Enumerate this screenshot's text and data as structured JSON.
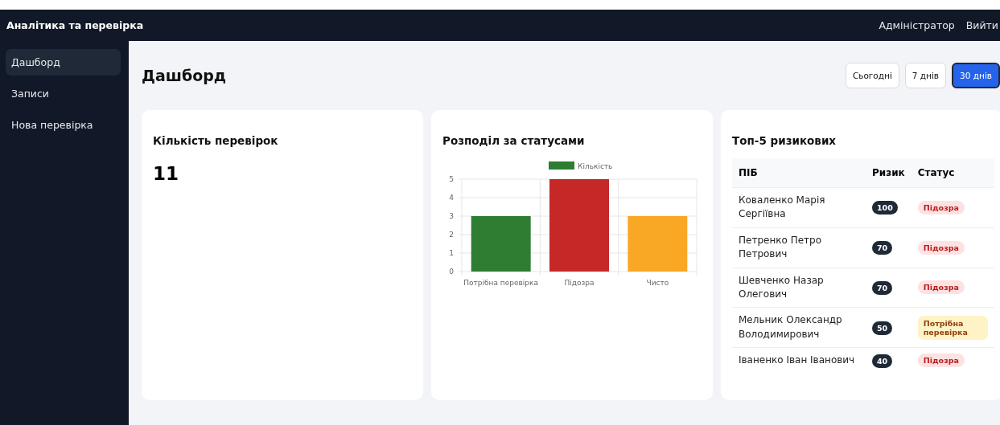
{
  "header": {
    "title": "Аналітика та перевірка",
    "user": "Адміністратор",
    "logout": "Вийти"
  },
  "sidebar": {
    "items": [
      {
        "label": "Дашборд",
        "selected": true
      },
      {
        "label": "Записи",
        "selected": false
      },
      {
        "label": "Нова перевірка",
        "selected": false
      }
    ]
  },
  "page": {
    "title": "Дашборд",
    "ranges": [
      {
        "label": "Сьогодні",
        "selected": false
      },
      {
        "label": "7 днів",
        "selected": false
      },
      {
        "label": "30 днів",
        "selected": true
      }
    ]
  },
  "count_card": {
    "title": "Кількість перевірок",
    "value": "11"
  },
  "status_card": {
    "title": "Розподіл за статусами",
    "chart_data": {
      "type": "bar",
      "categories": [
        "Потрібна перевірка",
        "Підозра",
        "Чисто"
      ],
      "series": [
        {
          "name": "Кількість",
          "color": "#2e7d32",
          "values": [
            3,
            null,
            null
          ]
        },
        {
          "color": "#c62828",
          "values": [
            null,
            5,
            null
          ]
        },
        {
          "color": "#f9a825",
          "values": [
            null,
            null,
            3
          ]
        }
      ],
      "stacked": true,
      "ylim": [
        0,
        5
      ],
      "yticks": [
        0,
        1,
        2,
        3,
        4,
        5
      ],
      "grid": true
    }
  },
  "top_card": {
    "title": "Топ-5 ризикових",
    "columns": [
      "ПІБ",
      "Ризик",
      "Статус"
    ],
    "rows": [
      {
        "name": "Коваленко Марія Сергіївна",
        "risk": "100",
        "status": "Підозра",
        "kind": "suspicious"
      },
      {
        "name": "Петренко Петро Петрович",
        "risk": "70",
        "status": "Підозра",
        "kind": "suspicious"
      },
      {
        "name": "Шевченко Назар Олегович",
        "risk": "70",
        "status": "Підозра",
        "kind": "suspicious"
      },
      {
        "name": "Мельник Олександр Володимирович",
        "risk": "50",
        "status": "Потрібна перевірка",
        "kind": "needs_check"
      },
      {
        "name": "Іваненко Іван Іванович",
        "risk": "40",
        "status": "Підозра",
        "kind": "suspicious"
      }
    ]
  }
}
